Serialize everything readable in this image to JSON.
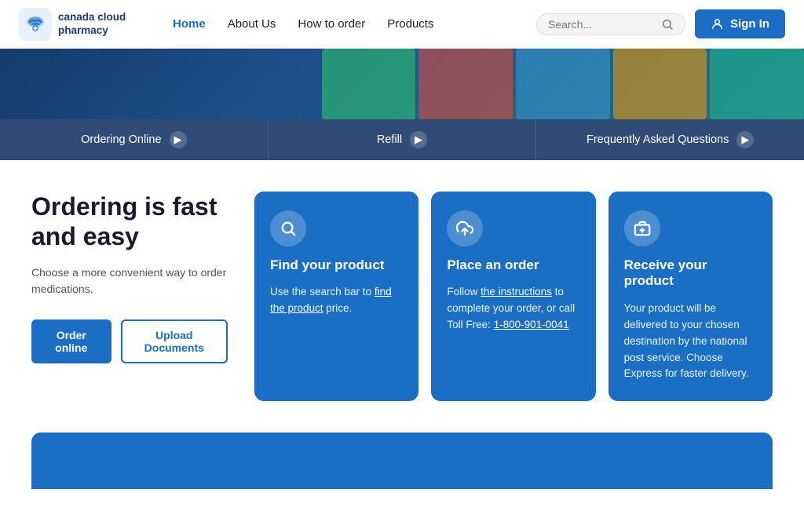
{
  "navbar": {
    "logo_text": "canada cloud pharmacy",
    "links": [
      {
        "label": "Home",
        "active": true
      },
      {
        "label": "About Us",
        "active": false
      },
      {
        "label": "How to order",
        "active": false
      },
      {
        "label": "Products",
        "active": false
      }
    ],
    "search_placeholder": "Search...",
    "sign_in_label": "Sign In"
  },
  "quick_links": [
    {
      "label": "Ordering Online"
    },
    {
      "label": "Refill"
    },
    {
      "label": "Frequently Asked Questions"
    }
  ],
  "hero": {
    "heading": "Ordering is fast and easy",
    "subtext": "Choose a more convenient way to order medications.",
    "btn_primary": "Order online",
    "btn_secondary": "Upload Documents"
  },
  "cards": [
    {
      "icon": "search",
      "title": "Find your product",
      "body_parts": [
        {
          "text": "Use the search bar to "
        },
        {
          "link": "find the product",
          "href": "#"
        },
        {
          "text": " price."
        }
      ]
    },
    {
      "icon": "upload",
      "title": "Place an order",
      "body_parts": [
        {
          "text": "Follow "
        },
        {
          "link": "the instructions",
          "href": "#"
        },
        {
          "text": " to complete your order, or call Toll Free: "
        },
        {
          "link": "1-800-901-0041",
          "href": "#"
        }
      ]
    },
    {
      "icon": "box",
      "title": "Receive your product",
      "body_parts": [
        {
          "text": "Your product will be delivered to your chosen destination by the national post service. Choose Express for faster delivery."
        }
      ]
    }
  ]
}
